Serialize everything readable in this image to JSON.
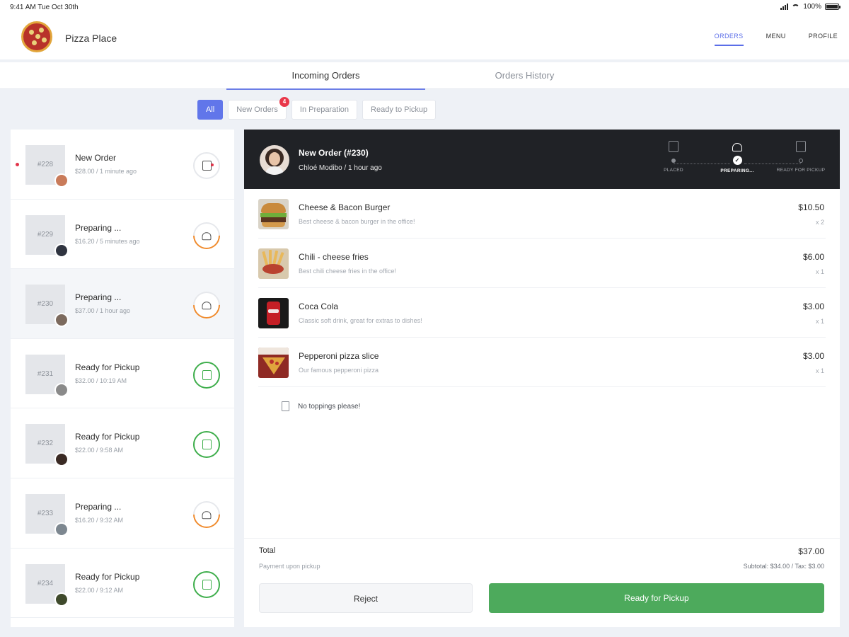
{
  "status_bar": {
    "time": "9:41 AM   Tue Oct 30th",
    "battery": "100%"
  },
  "app": {
    "name": "Pizza Place"
  },
  "topnav": {
    "orders": "ORDERS",
    "menu": "MENU",
    "profile": "PROFILE"
  },
  "tabs": {
    "incoming": "Incoming Orders",
    "history": "Orders History"
  },
  "filters": {
    "all": "All",
    "new_orders": "New Orders",
    "new_orders_count": "4",
    "in_preparation": "In Preparation",
    "ready_to_pickup": "Ready to Pickup"
  },
  "orders": [
    {
      "number": "#228",
      "status": "New Order",
      "meta": "$28.00 / 1 minute ago",
      "avatar_color": "#c97b5a"
    },
    {
      "number": "#229",
      "status": "Preparing ...",
      "meta": "$16.20 / 5 minutes ago",
      "avatar_color": "#2f3440"
    },
    {
      "number": "#230",
      "status": "Preparing ...",
      "meta": "$37.00 / 1 hour ago",
      "avatar_color": "#7c6a5e"
    },
    {
      "number": "#231",
      "status": "Ready for Pickup",
      "meta": "$32.00 / 10:19 AM",
      "avatar_color": "#8a8a8a"
    },
    {
      "number": "#232",
      "status": "Ready for Pickup",
      "meta": "$22.00 / 9:58 AM",
      "avatar_color": "#3a2a24"
    },
    {
      "number": "#233",
      "status": "Preparing ...",
      "meta": "$16.20 / 9:32 AM",
      "avatar_color": "#7d8790"
    },
    {
      "number": "#234",
      "status": "Ready for Pickup",
      "meta": "$22.00 / 9:12 AM",
      "avatar_color": "#3f4a2c"
    }
  ],
  "detail": {
    "title": "New Order (#230)",
    "subtitle": "Chloé Modibo / 1 hour ago",
    "steps": {
      "placed": "PLACED",
      "preparing": "PREPARING...",
      "ready": "READY FOR PICKUP"
    },
    "items": [
      {
        "name": "Cheese & Bacon Burger",
        "desc": "Best cheese & bacon burger in the office!",
        "price": "$10.50",
        "qty": "x 2"
      },
      {
        "name": "Chili - cheese fries",
        "desc": "Best chili cheese fries in the office!",
        "price": "$6.00",
        "qty": "x 1"
      },
      {
        "name": "Coca Cola",
        "desc": "Classic soft drink, great for extras to dishes!",
        "price": "$3.00",
        "qty": "x 1"
      },
      {
        "name": "Pepperoni pizza slice",
        "desc": "Our famous pepperoni pizza",
        "price": "$3.00",
        "qty": "x 1"
      }
    ],
    "note": "No toppings please!",
    "total_label": "Total",
    "total_value": "$37.00",
    "payment": "Payment upon pickup",
    "subtotal": "Subtotal: $34.00 / Tax: $3.00",
    "reject_label": "Reject",
    "ready_label": "Ready for Pickup"
  },
  "colors": {
    "accent": "#6176ea",
    "ready": "#4daa5c",
    "preparing": "#f08b2d",
    "alert": "#e2344a"
  }
}
